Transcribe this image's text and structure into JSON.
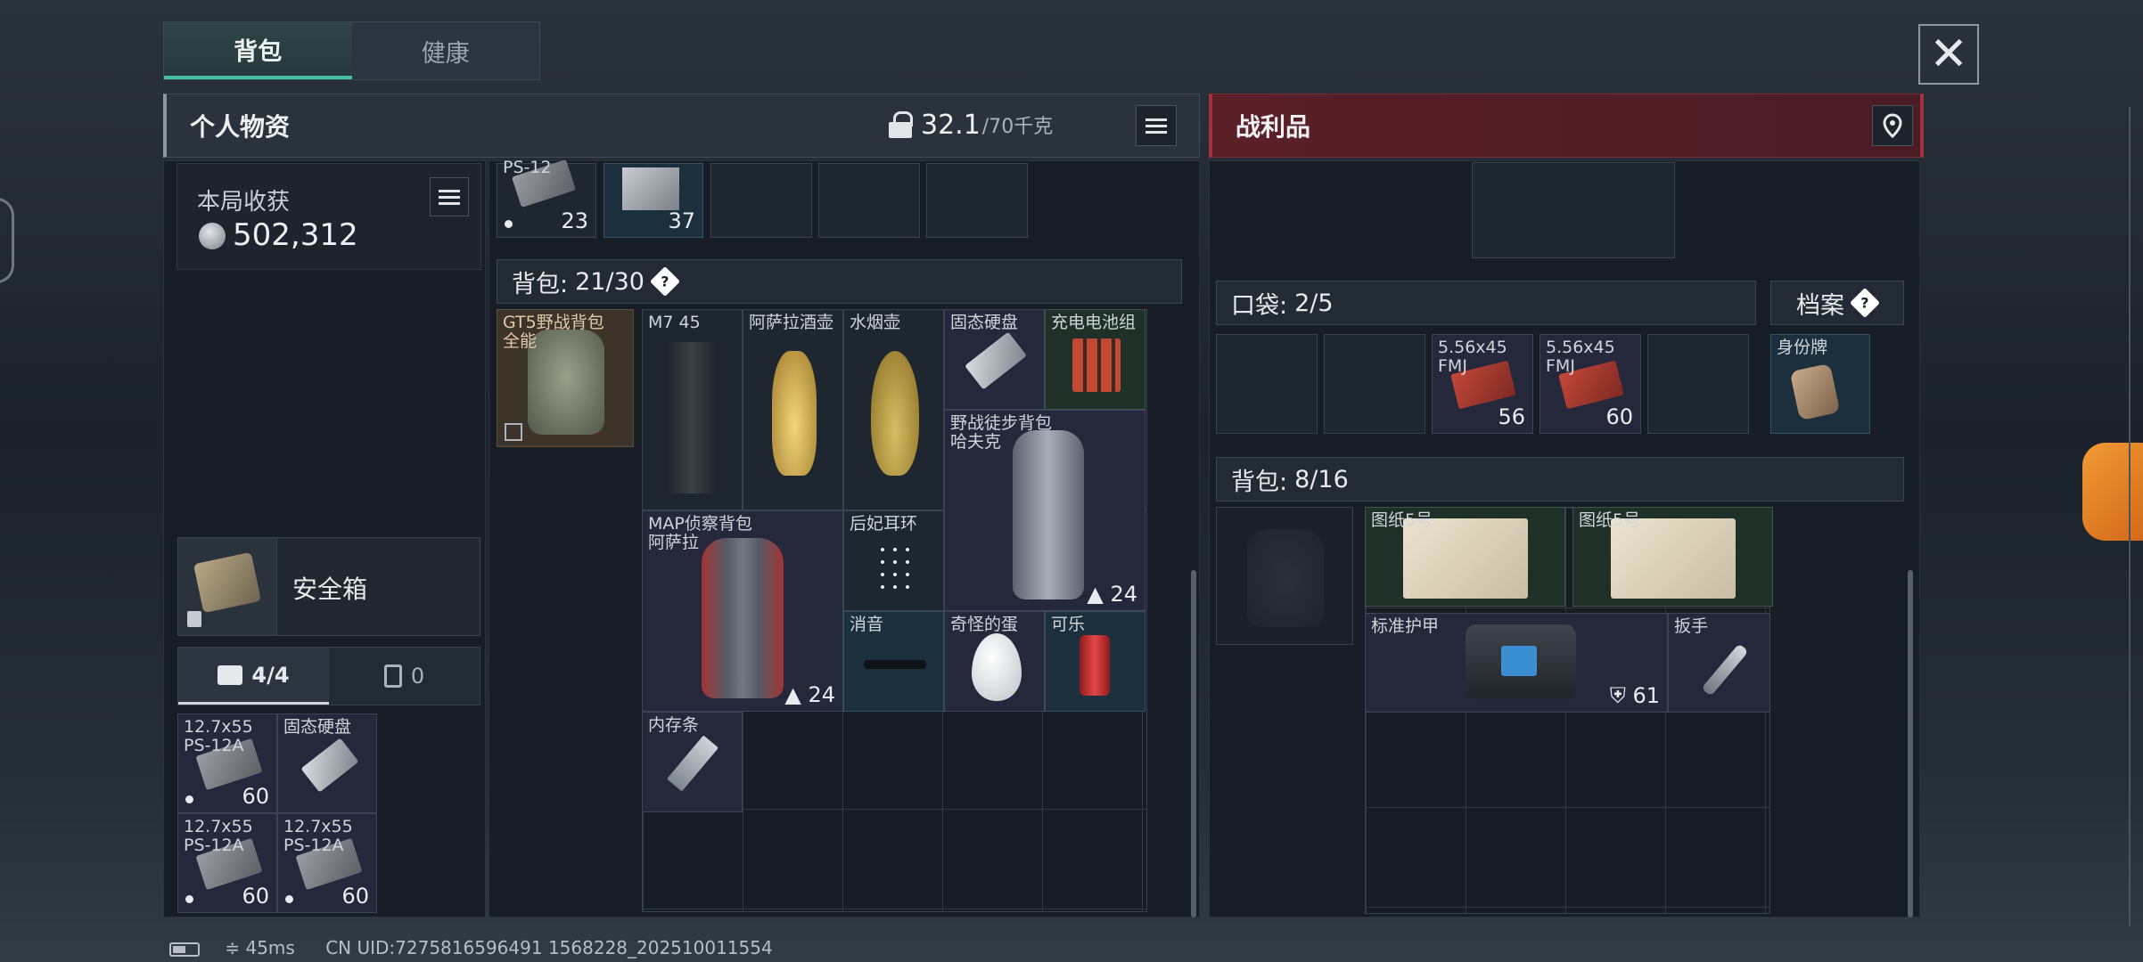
{
  "tabs": {
    "backpack": "背包",
    "health": "健康"
  },
  "close_label": "✕",
  "personal": {
    "title": "个人物资",
    "weight_value": "32.1",
    "weight_max": "/70千克",
    "earnings_label": "本局收获",
    "earnings_value": "502,312",
    "safebox_label": "安全箱",
    "tab_items": "4/4",
    "tab_other": "0",
    "safebox_items": [
      {
        "label": "12.7x55\nPS-12A",
        "count": "60"
      },
      {
        "label": "固态硬盘",
        "count": ""
      },
      {
        "label": "12.7x55\nPS-12A",
        "count": "60"
      },
      {
        "label": "12.7x55\nPS-12A",
        "count": "60"
      }
    ],
    "top_row": [
      {
        "label": "PS-12",
        "count": "23"
      },
      {
        "label": "",
        "count": "37"
      }
    ],
    "backpack_label": "背包:",
    "backpack_value": "21/30",
    "equipped_bag": "GT5野战背包\n全能",
    "items": {
      "m7": "M7 45",
      "asala_jug": "阿萨拉酒壶",
      "hookah": "水烟壶",
      "ssd": "固态硬盘",
      "battery": "充电电池组",
      "hiking_bag": "野战徒步背包\n哈夫克",
      "hiking_bag_count": "24",
      "map_bag": "MAP侦察背包\n阿萨拉",
      "map_bag_count": "24",
      "earrings": "后妃耳环",
      "silencer": "消音",
      "egg": "奇怪的蛋",
      "cola": "可乐",
      "ram": "内存条"
    }
  },
  "loot": {
    "title": "战利品",
    "pocket_label": "口袋:",
    "pocket_value": "2/5",
    "archive_label": "档案",
    "pocket_items": [
      {
        "label": "5.56x45\nFMJ",
        "count": "56"
      },
      {
        "label": "5.56x45\nFMJ",
        "count": "60"
      }
    ],
    "dogtag": "身份牌",
    "backpack_label": "背包:",
    "backpack_value": "8/16",
    "blueprint_1": "图纸5号",
    "blueprint_2": "图纸5号",
    "armor": "标准护甲",
    "armor_value": "61",
    "wrench": "扳手"
  },
  "status": {
    "ping": "45ms",
    "uid": "CN UID:7275816596491 1568228_202510011554"
  },
  "colors": {
    "accent_green": "#45c0a2",
    "loot_red": "#5b1f27"
  }
}
